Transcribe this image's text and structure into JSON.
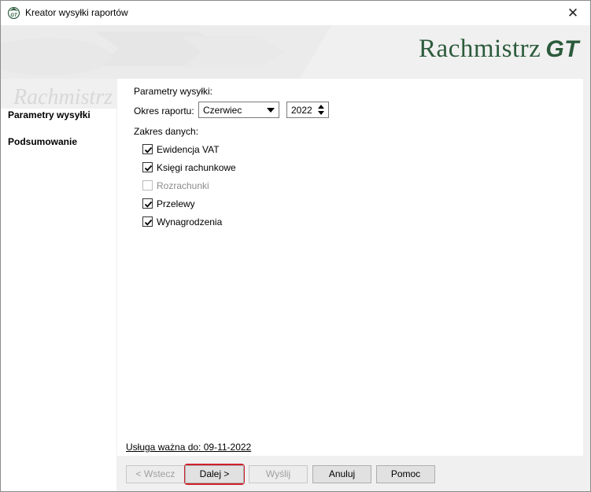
{
  "window": {
    "title": "Kreator wysyłki raportów"
  },
  "banner": {
    "brand": "Rachmistrz",
    "brand_suffix": "GT",
    "brand_color": "#2c5b3c"
  },
  "sidebar": {
    "items": [
      {
        "label": "Parametry wysyłki",
        "active": true
      },
      {
        "label": "Podsumowanie",
        "active": false
      }
    ]
  },
  "form": {
    "section_title": "Parametry wysyłki:",
    "period_label": "Okres raportu:",
    "month_value": "Czerwiec",
    "year_value": "2022",
    "scope_label": "Zakres danych:",
    "checkboxes": [
      {
        "label": "Ewidencja VAT",
        "checked": true,
        "enabled": true
      },
      {
        "label": "Księgi rachunkowe",
        "checked": true,
        "enabled": true
      },
      {
        "label": "Rozrachunki",
        "checked": false,
        "enabled": false
      },
      {
        "label": "Przelewy",
        "checked": true,
        "enabled": true
      },
      {
        "label": "Wynagrodzenia",
        "checked": true,
        "enabled": true
      }
    ],
    "validity_link": "Usługa ważna do: 09-11-2022"
  },
  "buttons": {
    "back": "< Wstecz",
    "next": "Dalej >",
    "send": "Wyślij",
    "cancel": "Anuluj",
    "help": "Pomoc"
  },
  "colors": {
    "highlight": "#d0202a"
  }
}
